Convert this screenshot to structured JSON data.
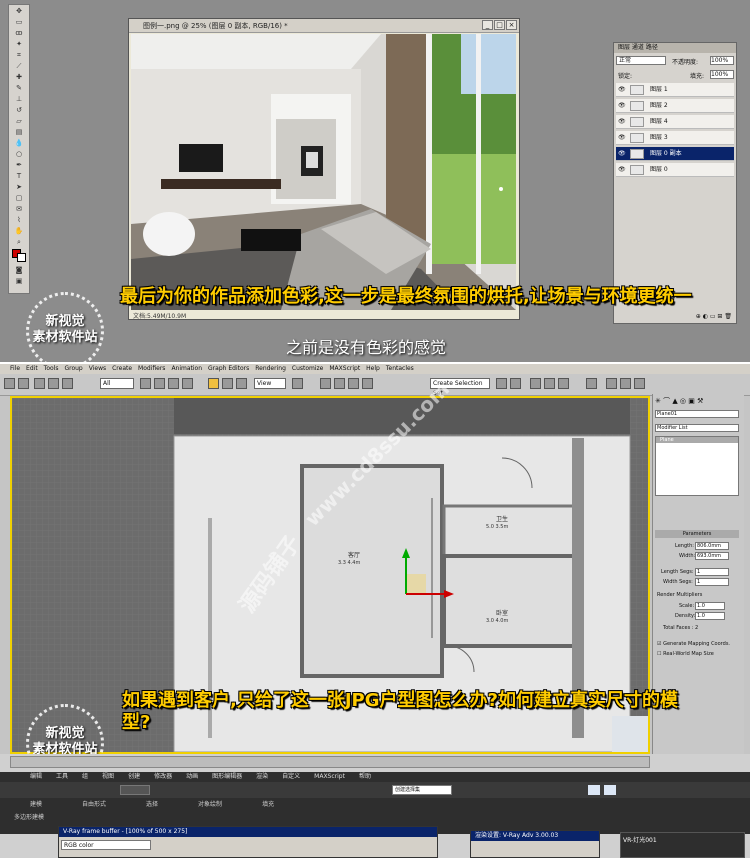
{
  "photoshop": {
    "doc_title": "图例一.png @ 25% (图层 0 副本, RGB/16) *",
    "status_text": "文档:5.49M/10.9M",
    "layers_tabs": "图层  通道  路径",
    "blend_mode": "正常",
    "opacity_label": "不透明度:",
    "opacity_value": "100%",
    "lock_label": "锁定:",
    "fill_label": "填充:",
    "fill_value": "100%",
    "layers": [
      "图层 1",
      "图层 2",
      "图层 4",
      "图层 3",
      "图层 0 副本",
      "图层 0"
    ],
    "selected_layer": "图层 0 副本"
  },
  "caption_top": "最后为你的作品添加色彩,这一步是最终氛围的烘托,让场景与环境更统一",
  "subtitle_top": "之前是没有色彩的感觉",
  "logo": {
    "line1": "新视觉",
    "line2": "素材软件站"
  },
  "max": {
    "menu": [
      "File",
      "Edit",
      "Tools",
      "Group",
      "Views",
      "Create",
      "Modifiers",
      "Animation",
      "Graph Editors",
      "Rendering",
      "Customize",
      "MAXScript",
      "Help",
      "Tentacles"
    ],
    "selection_filter": "All",
    "view_dropdown": "View",
    "named_selection": "Create Selection Set",
    "object_name": "Plane01",
    "modifier_list": "Modifier List",
    "stack_item": "Plane",
    "rollout_title": "Parameters",
    "length_label": "Length:",
    "length_value": "806.0mm",
    "width_label": "Width:",
    "width_value": "693.0mm",
    "length_segs_label": "Length Segs:",
    "length_segs_value": "1",
    "width_segs_label": "Width Segs:",
    "width_segs_value": "1",
    "render_mult_label": "Render Multipliers",
    "scale_label": "Scale:",
    "scale_value": "1.0",
    "density_label": "Density:",
    "density_value": "1.0",
    "total_faces": "Total Faces : 2",
    "gen_mapping": "Generate Mapping Coords.",
    "real_world": "Real-World Map Size"
  },
  "caption_bottom": "如果遇到客户,只给了这一张JPG户型图怎么办?如何建立真实尺寸的模型?",
  "watermarks": [
    "源码铺子",
    "www.cd8ssu.com"
  ],
  "floorplan": {
    "room1": "客厅",
    "room1_dim": "3.3 4.4m",
    "room2": "卧室",
    "room2_dim": "3.0 4.0m",
    "room3": "卫生",
    "room3_dim": "5.0 3.5m"
  },
  "bottom": {
    "menu_cn": [
      "编辑",
      "工具",
      "组",
      "视图",
      "创建",
      "修改器",
      "动画",
      "图形编辑器",
      "渲染",
      "自定义",
      "MAXScript",
      "帮助"
    ],
    "ribbon_tabs": [
      "建模",
      "自由形式",
      "选择",
      "对象绘制",
      "填充"
    ],
    "sub_label": "多边形建模",
    "vray_title": "V-Ray frame buffer - [100% of 500 x 275]",
    "vray_channel": "RGB color",
    "vray2_title": "渲染设置: V-Ray Adv 3.00.03",
    "vray3_title": "VR-灯光001",
    "selection_set": "创建选择集"
  },
  "colors": {
    "caption": "#ffcc00",
    "selection_border": "#f0d000",
    "selected_layer_bg": "#0a246a"
  }
}
